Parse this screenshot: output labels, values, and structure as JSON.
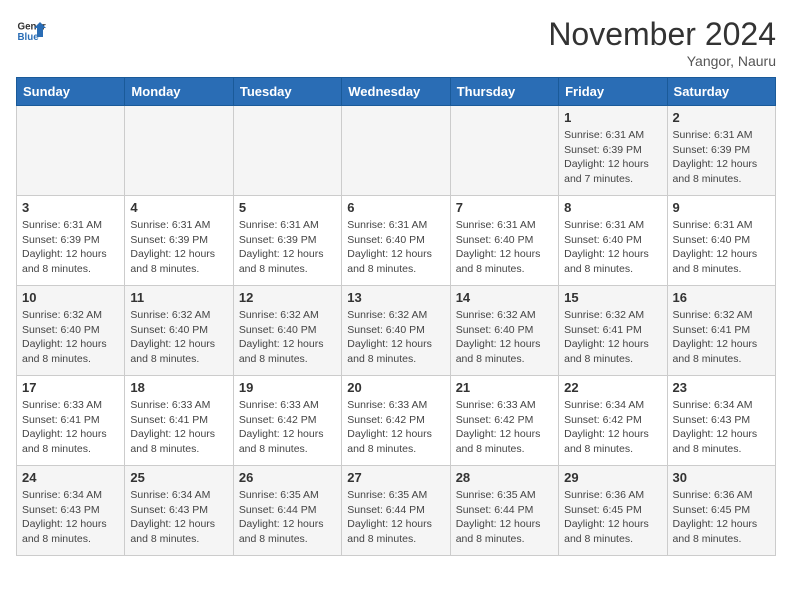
{
  "header": {
    "logo_line1": "General",
    "logo_line2": "Blue",
    "month": "November 2024",
    "location": "Yangor, Nauru"
  },
  "days_of_week": [
    "Sunday",
    "Monday",
    "Tuesday",
    "Wednesday",
    "Thursday",
    "Friday",
    "Saturday"
  ],
  "weeks": [
    [
      {
        "day": "",
        "info": ""
      },
      {
        "day": "",
        "info": ""
      },
      {
        "day": "",
        "info": ""
      },
      {
        "day": "",
        "info": ""
      },
      {
        "day": "",
        "info": ""
      },
      {
        "day": "1",
        "info": "Sunrise: 6:31 AM\nSunset: 6:39 PM\nDaylight: 12 hours and 7 minutes."
      },
      {
        "day": "2",
        "info": "Sunrise: 6:31 AM\nSunset: 6:39 PM\nDaylight: 12 hours and 8 minutes."
      }
    ],
    [
      {
        "day": "3",
        "info": "Sunrise: 6:31 AM\nSunset: 6:39 PM\nDaylight: 12 hours and 8 minutes."
      },
      {
        "day": "4",
        "info": "Sunrise: 6:31 AM\nSunset: 6:39 PM\nDaylight: 12 hours and 8 minutes."
      },
      {
        "day": "5",
        "info": "Sunrise: 6:31 AM\nSunset: 6:39 PM\nDaylight: 12 hours and 8 minutes."
      },
      {
        "day": "6",
        "info": "Sunrise: 6:31 AM\nSunset: 6:40 PM\nDaylight: 12 hours and 8 minutes."
      },
      {
        "day": "7",
        "info": "Sunrise: 6:31 AM\nSunset: 6:40 PM\nDaylight: 12 hours and 8 minutes."
      },
      {
        "day": "8",
        "info": "Sunrise: 6:31 AM\nSunset: 6:40 PM\nDaylight: 12 hours and 8 minutes."
      },
      {
        "day": "9",
        "info": "Sunrise: 6:31 AM\nSunset: 6:40 PM\nDaylight: 12 hours and 8 minutes."
      }
    ],
    [
      {
        "day": "10",
        "info": "Sunrise: 6:32 AM\nSunset: 6:40 PM\nDaylight: 12 hours and 8 minutes."
      },
      {
        "day": "11",
        "info": "Sunrise: 6:32 AM\nSunset: 6:40 PM\nDaylight: 12 hours and 8 minutes."
      },
      {
        "day": "12",
        "info": "Sunrise: 6:32 AM\nSunset: 6:40 PM\nDaylight: 12 hours and 8 minutes."
      },
      {
        "day": "13",
        "info": "Sunrise: 6:32 AM\nSunset: 6:40 PM\nDaylight: 12 hours and 8 minutes."
      },
      {
        "day": "14",
        "info": "Sunrise: 6:32 AM\nSunset: 6:40 PM\nDaylight: 12 hours and 8 minutes."
      },
      {
        "day": "15",
        "info": "Sunrise: 6:32 AM\nSunset: 6:41 PM\nDaylight: 12 hours and 8 minutes."
      },
      {
        "day": "16",
        "info": "Sunrise: 6:32 AM\nSunset: 6:41 PM\nDaylight: 12 hours and 8 minutes."
      }
    ],
    [
      {
        "day": "17",
        "info": "Sunrise: 6:33 AM\nSunset: 6:41 PM\nDaylight: 12 hours and 8 minutes."
      },
      {
        "day": "18",
        "info": "Sunrise: 6:33 AM\nSunset: 6:41 PM\nDaylight: 12 hours and 8 minutes."
      },
      {
        "day": "19",
        "info": "Sunrise: 6:33 AM\nSunset: 6:42 PM\nDaylight: 12 hours and 8 minutes."
      },
      {
        "day": "20",
        "info": "Sunrise: 6:33 AM\nSunset: 6:42 PM\nDaylight: 12 hours and 8 minutes."
      },
      {
        "day": "21",
        "info": "Sunrise: 6:33 AM\nSunset: 6:42 PM\nDaylight: 12 hours and 8 minutes."
      },
      {
        "day": "22",
        "info": "Sunrise: 6:34 AM\nSunset: 6:42 PM\nDaylight: 12 hours and 8 minutes."
      },
      {
        "day": "23",
        "info": "Sunrise: 6:34 AM\nSunset: 6:43 PM\nDaylight: 12 hours and 8 minutes."
      }
    ],
    [
      {
        "day": "24",
        "info": "Sunrise: 6:34 AM\nSunset: 6:43 PM\nDaylight: 12 hours and 8 minutes."
      },
      {
        "day": "25",
        "info": "Sunrise: 6:34 AM\nSunset: 6:43 PM\nDaylight: 12 hours and 8 minutes."
      },
      {
        "day": "26",
        "info": "Sunrise: 6:35 AM\nSunset: 6:44 PM\nDaylight: 12 hours and 8 minutes."
      },
      {
        "day": "27",
        "info": "Sunrise: 6:35 AM\nSunset: 6:44 PM\nDaylight: 12 hours and 8 minutes."
      },
      {
        "day": "28",
        "info": "Sunrise: 6:35 AM\nSunset: 6:44 PM\nDaylight: 12 hours and 8 minutes."
      },
      {
        "day": "29",
        "info": "Sunrise: 6:36 AM\nSunset: 6:45 PM\nDaylight: 12 hours and 8 minutes."
      },
      {
        "day": "30",
        "info": "Sunrise: 6:36 AM\nSunset: 6:45 PM\nDaylight: 12 hours and 8 minutes."
      }
    ]
  ]
}
